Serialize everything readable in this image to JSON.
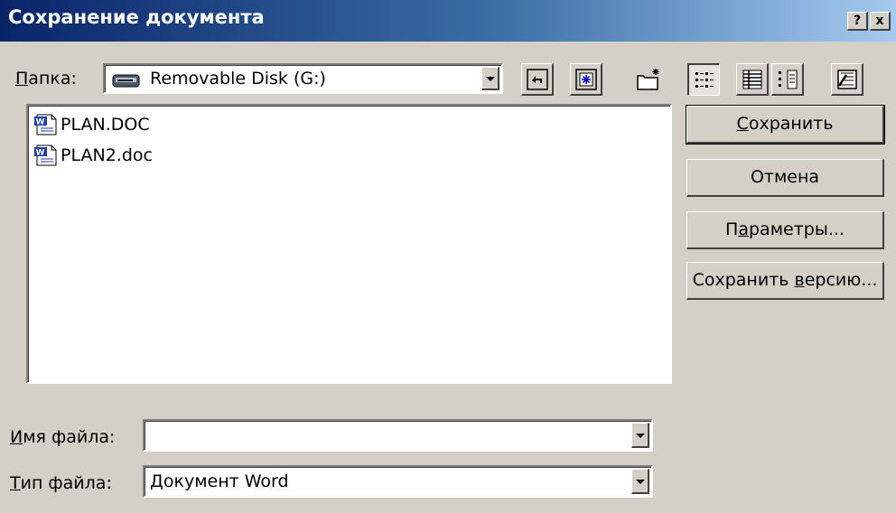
{
  "window": {
    "title": "Сохранение документа",
    "help_button": "?",
    "close_button": "x"
  },
  "folder": {
    "label_accel": "П",
    "label_rest": "апка:",
    "value": "Removable Disk (G:)",
    "icon": "removable-disk-icon"
  },
  "toolbar": {
    "buttons": [
      "back-icon",
      "up-folder-icon",
      "search-web-icon",
      "new-folder-icon",
      "list-view-icon",
      "details-view-icon",
      "properties-view-icon",
      "tools-icon"
    ]
  },
  "files": [
    {
      "name": "PLAN.DOC",
      "icon": "word-document-icon"
    },
    {
      "name": "PLAN2.doc",
      "icon": "word-document-icon"
    }
  ],
  "buttons": {
    "save": {
      "accel": "С",
      "rest": "охранить"
    },
    "cancel": {
      "label": "Отмена"
    },
    "options": {
      "pre": "П",
      "accel": "а",
      "rest": "раметры..."
    },
    "save_version": {
      "pre": "Сохранить ",
      "accel": "в",
      "rest": "ерсию..."
    }
  },
  "filename": {
    "label_accel": "И",
    "label_rest": "мя файла:",
    "value": ""
  },
  "filetype": {
    "label_accel": "Т",
    "label_rest": "ип файла:",
    "value": "Документ Word"
  },
  "colors": {
    "title_gradient_start": "#0a246a",
    "title_gradient_end": "#a6caf0",
    "face": "#d4d0c8"
  }
}
